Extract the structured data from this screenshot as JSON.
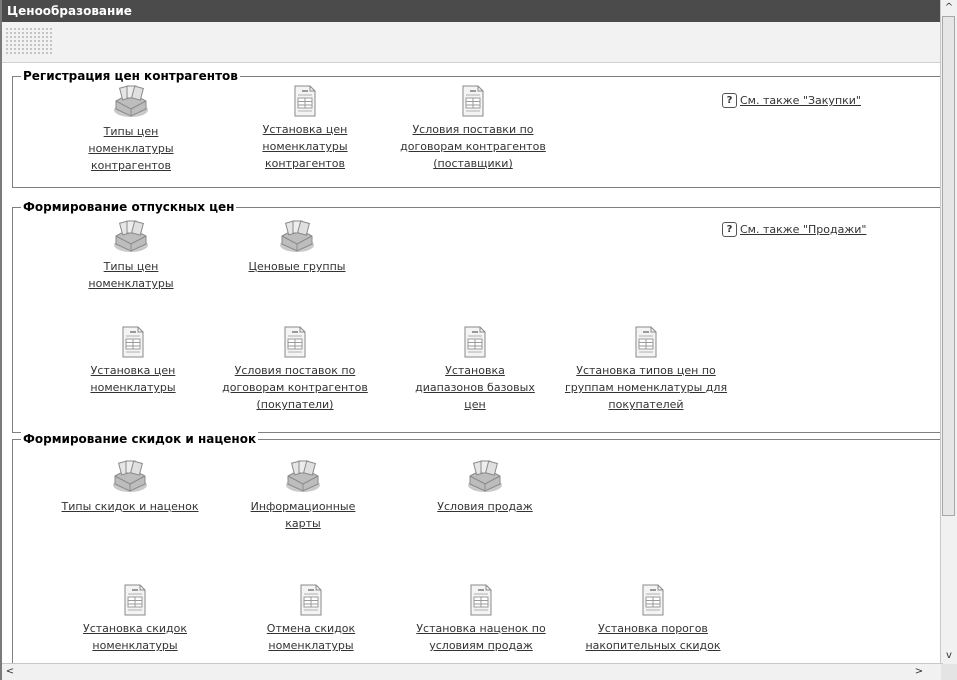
{
  "window": {
    "title": "Ценообразование"
  },
  "groups": [
    {
      "title": "Регистрация цен контрагентов",
      "see_also": "См. также \"Закупки\"",
      "items": [
        {
          "label": "Типы цен номенклатуры контрагентов",
          "icon": "catalog-icon"
        },
        {
          "label": "Установка цен номенклатуры контрагентов",
          "icon": "document-icon"
        },
        {
          "label": "Условия поставки по договорам контрагентов (поставщики)",
          "icon": "document-icon"
        }
      ]
    },
    {
      "title": "Формирование отпускных цен",
      "see_also": "См. также \"Продажи\"",
      "items": [
        {
          "label": "Типы цен номенклатуры",
          "icon": "catalog-icon"
        },
        {
          "label": "Ценовые группы",
          "icon": "catalog-icon"
        },
        {
          "label": "Установка цен номенклатуры",
          "icon": "document-icon"
        },
        {
          "label": "Условия поставок по договорам контрагентов (покупатели)",
          "icon": "document-icon"
        },
        {
          "label": "Установка диапазонов базовых цен",
          "icon": "document-icon"
        },
        {
          "label": "Установка типов цен по группам номенклатуры для покупателей",
          "icon": "document-icon"
        }
      ]
    },
    {
      "title": "Формирование скидок и наценок",
      "items": [
        {
          "label": "Типы скидок и наценок",
          "icon": "catalog-icon"
        },
        {
          "label": "Информационные карты",
          "icon": "catalog-icon"
        },
        {
          "label": "Условия продаж",
          "icon": "catalog-icon"
        },
        {
          "label": "Установка скидок номенклатуры",
          "icon": "document-icon"
        },
        {
          "label": "Отмена скидок номенклатуры",
          "icon": "document-icon"
        },
        {
          "label": "Установка наценок по условиям продаж",
          "icon": "document-icon"
        },
        {
          "label": "Установка порогов накопительных скидок",
          "icon": "document-icon"
        }
      ]
    }
  ],
  "help_glyph": "?",
  "scroll_arrows": {
    "up": "^",
    "down": "v",
    "left": "<",
    "right": ">"
  }
}
